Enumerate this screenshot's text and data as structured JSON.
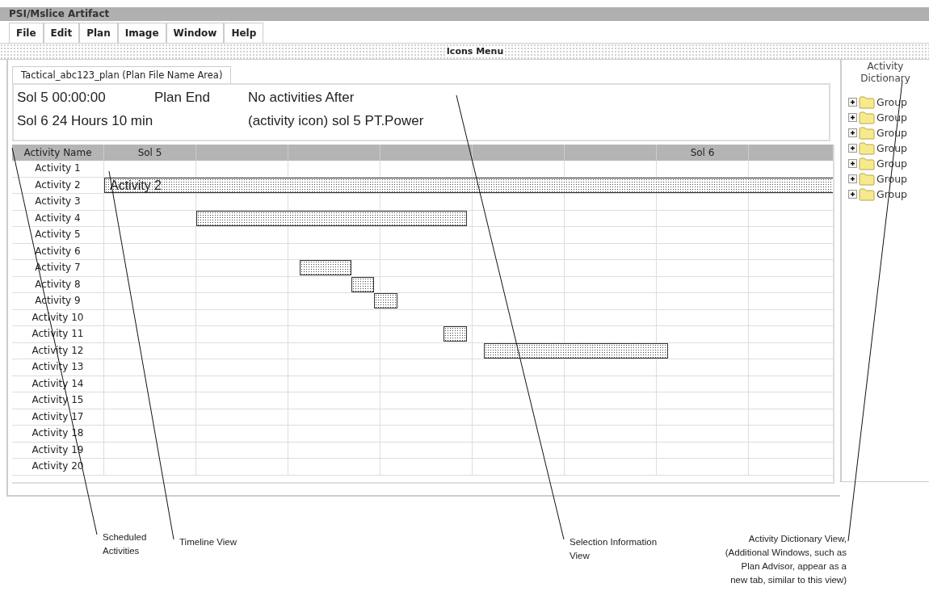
{
  "window": {
    "title": "PSI/Mslice Artifact"
  },
  "menu": [
    "File",
    "Edit",
    "Plan",
    "Image",
    "Window",
    "Help"
  ],
  "icons_menu": {
    "label": "Icons Menu"
  },
  "plan_tab": {
    "label": "Tactical_abc123_plan (Plan File Name Area)"
  },
  "selection_info": {
    "plan_start": "Sol 5 00:00:00",
    "plan_end_label": "Plan End",
    "plan_end": "Sol 6 24 Hours 10 min",
    "message": "No activities After",
    "detail": "(activity icon) sol 5 PT.Power"
  },
  "timeline": {
    "name_header": "Activity Name",
    "day_headers": [
      "Sol 5",
      "Sol 6"
    ],
    "rows": [
      {
        "name": "Activity 1"
      },
      {
        "name": "Activity 2",
        "has_bar": true,
        "bar_label": "Activity 2"
      },
      {
        "name": "Activity 3"
      },
      {
        "name": "Activity 4",
        "has_bar": true
      },
      {
        "name": "Activity 5"
      },
      {
        "name": "Activity 6"
      },
      {
        "name": "Activity 7",
        "has_bar": true
      },
      {
        "name": "Activity 8",
        "has_bar": true
      },
      {
        "name": "Activity 9",
        "has_bar": true
      },
      {
        "name": "Activity 10"
      },
      {
        "name": "Activity 11",
        "has_bar": true
      },
      {
        "name": "Activity 12",
        "has_bar": true
      },
      {
        "name": "Activity 13"
      },
      {
        "name": "Activity 14"
      },
      {
        "name": "Activity 15"
      },
      {
        "name": "Activity 17"
      },
      {
        "name": "Activity 18"
      },
      {
        "name": "Activity 19"
      },
      {
        "name": "Activity 20"
      }
    ]
  },
  "activity_dictionary": {
    "title": "Activity Dictionary",
    "items": [
      {
        "label": "Group",
        "expanded": false
      },
      {
        "label": "Group",
        "expanded": false
      },
      {
        "label": "Group",
        "expanded": false
      },
      {
        "label": "Group",
        "expanded": false
      },
      {
        "label": "Group",
        "expanded": false
      },
      {
        "label": "Group",
        "expanded": false
      },
      {
        "label": "Group",
        "expanded": false
      }
    ]
  },
  "annotations": [
    {
      "text": "Scheduled Activities"
    },
    {
      "text": "Timeline View"
    },
    {
      "text": "Selection Information View"
    },
    {
      "text": "Activity Dictionary View, (Additional Windows, such as Plan Advisor, appear as a new tab, similar to this view)"
    }
  ]
}
